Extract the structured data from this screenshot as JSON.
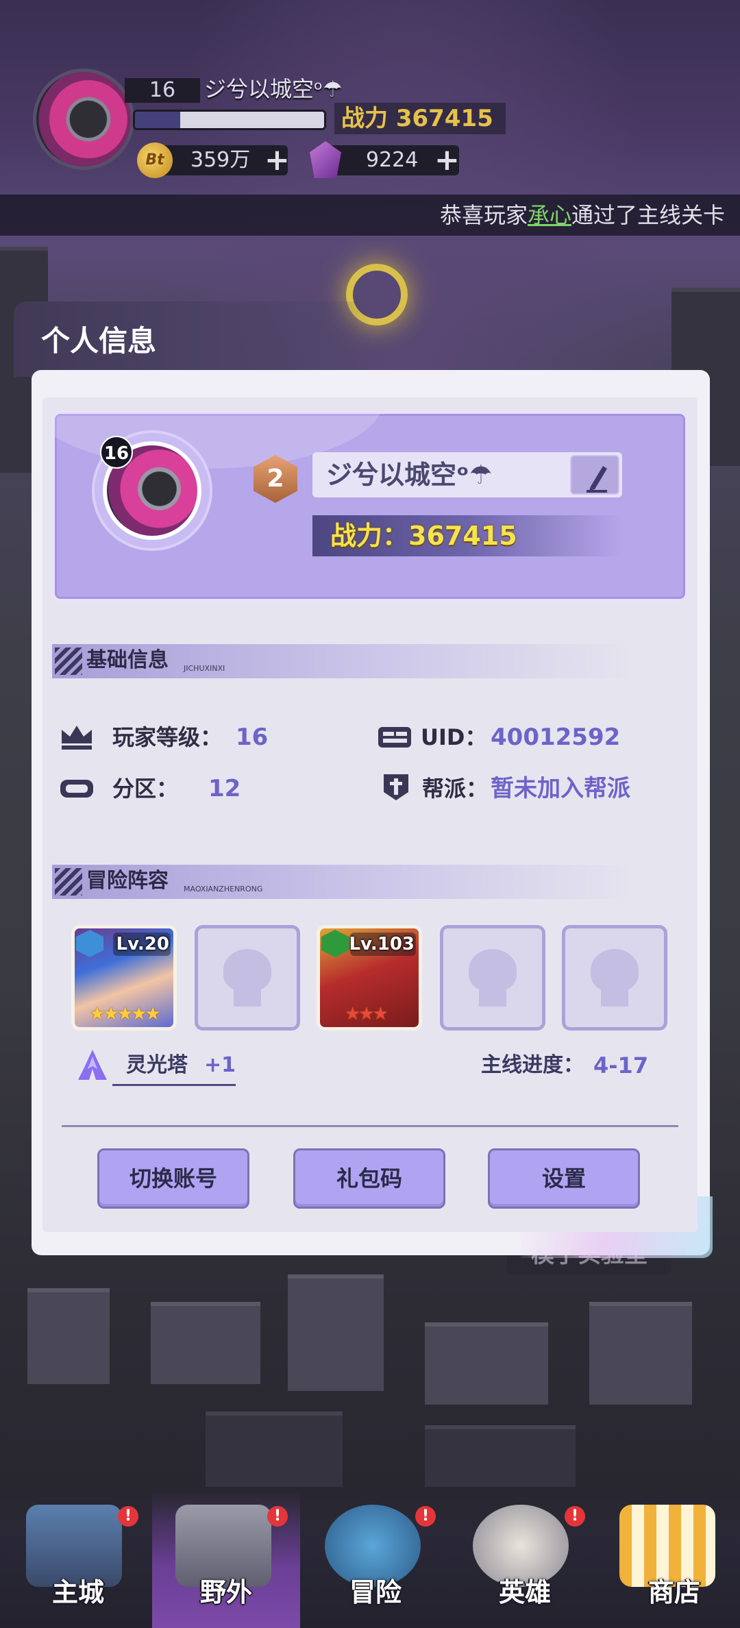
{
  "hud": {
    "level": "16",
    "player_name": "ジ兮以城空ᵒ☂",
    "exp_progress": 0.24,
    "power": "战力 367415",
    "gold": "359万",
    "gold_icon_text": "Bt",
    "gems": "9224",
    "plus": "+"
  },
  "ticker": {
    "prefix": "恭喜玩家",
    "player": "承心",
    "suffix": "通过了主线关卡"
  },
  "background": {
    "billboard_text": "模子实验室"
  },
  "panel": {
    "title": "个人信息",
    "profile": {
      "level_badge": "16",
      "rank": "2",
      "name": "ジ兮以城空ᵒ☂",
      "power": "战力：367415"
    },
    "basic_info": {
      "title": "基础信息",
      "subtitle": "JICHUXINXI",
      "player_level_label": "玩家等级：",
      "player_level_value": "16",
      "uid_label": "UID：",
      "uid_value": "40012592",
      "zone_label": "分区：",
      "zone_value": "12",
      "guild_label": "帮派：",
      "guild_value": "暂未加入帮派"
    },
    "lineup": {
      "title": "冒险阵容",
      "subtitle": "MAOXIANZHENRONG",
      "heroes": [
        {
          "level": "Lv.20",
          "stars": "★★★★★",
          "class_color": "#3d8fd8"
        },
        {
          "empty": true
        },
        {
          "level": "Lv.103",
          "stars": "★★★",
          "class_color": "#2f9a3c"
        },
        {
          "empty": true
        },
        {
          "empty": true
        }
      ],
      "tower_label": "灵光塔",
      "tower_value": "+1",
      "progress_label": "主线进度：",
      "progress_value": "4-17"
    },
    "buttons": {
      "switch_account": "切换账号",
      "gift_code": "礼包码",
      "settings": "设置"
    }
  },
  "nav": {
    "items": [
      {
        "label": "主城",
        "badge": "!"
      },
      {
        "label": "野外",
        "badge": "!"
      },
      {
        "label": "冒险",
        "badge": "!"
      },
      {
        "label": "英雄",
        "badge": "!"
      },
      {
        "label": "商店"
      }
    ],
    "active": "野外"
  },
  "colors": {
    "accent_purple": "#b0a4f2",
    "value_purple": "#6d63c8",
    "power_yellow": "#f7e24f",
    "ticker_highlight": "#7fd46a",
    "badge_red": "#e3363a"
  }
}
